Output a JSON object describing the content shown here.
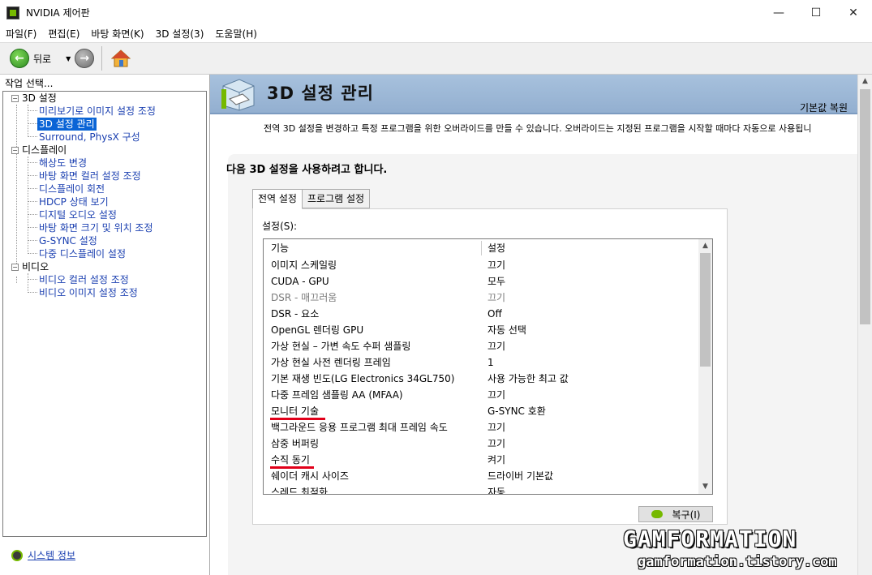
{
  "window": {
    "title": "NVIDIA 제어판",
    "minimize": "—",
    "maximize": "☐",
    "close": "✕"
  },
  "menu": [
    "파일(F)",
    "편집(E)",
    "바탕 화면(K)",
    "3D 설정(3)",
    "도움말(H)"
  ],
  "toolbar": {
    "back_label": "뒤로",
    "back_glyph": "←",
    "forward_glyph": "→",
    "dropdown_glyph": "▼"
  },
  "left": {
    "label": "작업 선택...",
    "tree": [
      {
        "text": "3D 설정",
        "type": "category",
        "expander": "−"
      },
      {
        "text": "미리보기로 이미지 설정 조정",
        "type": "link"
      },
      {
        "text": "3D 설정 관리",
        "type": "selected"
      },
      {
        "text": "Surround, PhysX 구성",
        "type": "link"
      },
      {
        "text": "디스플레이",
        "type": "category",
        "expander": "−"
      },
      {
        "text": "해상도 변경",
        "type": "link"
      },
      {
        "text": "바탕 화면 컬러 설정 조정",
        "type": "link"
      },
      {
        "text": "디스플레이 회전",
        "type": "link"
      },
      {
        "text": "HDCP 상태 보기",
        "type": "link"
      },
      {
        "text": "디지털 오디오 설정",
        "type": "link"
      },
      {
        "text": "바탕 화면 크기 및 위치 조정",
        "type": "link"
      },
      {
        "text": "G-SYNC 설정",
        "type": "link"
      },
      {
        "text": "다중 디스플레이 설정",
        "type": "link"
      },
      {
        "text": "비디오",
        "type": "category",
        "expander": "−"
      },
      {
        "text": "비디오 컬러 설정 조정",
        "type": "link"
      },
      {
        "text": "비디오 이미지 설정 조정",
        "type": "link"
      }
    ],
    "system_info": "시스템 정보"
  },
  "main": {
    "title": "3D 설정 관리",
    "restore_default": "기본값 복원",
    "description": "전역 3D 설정을 변경하고 특정 프로그램을 위한 오버라이드를 만들 수 있습니다. 오버라이드는 지정된 프로그램을 시작할 때마다 자동으로 사용됩니",
    "section_title": "다음 3D 설정을 사용하려고 합니다.",
    "tabs": [
      "전역 설정",
      "프로그램 설정"
    ],
    "settings_label": "설정(S):",
    "table": {
      "col_feature": "기능",
      "col_setting": "설정",
      "rows": [
        {
          "feature": "이미지 스케일링",
          "value": "끄기",
          "dim": false
        },
        {
          "feature": "CUDA - GPU",
          "value": "모두",
          "dim": false
        },
        {
          "feature": "DSR - 매끄러움",
          "value": "끄기",
          "dim": true
        },
        {
          "feature": "DSR - 요소",
          "value": "Off",
          "dim": false
        },
        {
          "feature": "OpenGL 렌더링 GPU",
          "value": "자동 선택",
          "dim": false
        },
        {
          "feature": "가상 현실 – 가변 속도 수퍼 샘플링",
          "value": "끄기",
          "dim": false
        },
        {
          "feature": "가상 현실 사전 렌더링 프레임",
          "value": "1",
          "dim": false
        },
        {
          "feature": "기본 재생 빈도(LG Electronics 34GL750)",
          "value": "사용 가능한 최고 값",
          "dim": false
        },
        {
          "feature": "다중 프레임 샘플링 AA (MFAA)",
          "value": "끄기",
          "dim": false
        },
        {
          "feature": "모니터 기술",
          "value": "G-SYNC 호환",
          "dim": false,
          "highlight": true
        },
        {
          "feature": "백그라운드 응용 프로그램 최대 프레임 속도",
          "value": "끄기",
          "dim": false
        },
        {
          "feature": "삼중 버퍼링",
          "value": "끄기",
          "dim": false
        },
        {
          "feature": "수직 동기",
          "value": "켜기",
          "dim": false,
          "highlight": true
        },
        {
          "feature": "쉐이더 캐시 사이즈",
          "value": "드라이버 기본값",
          "dim": false
        },
        {
          "feature": "스레드 최적화",
          "value": "자동",
          "dim": false
        }
      ]
    },
    "restore_button": "복구(I)"
  },
  "watermark": {
    "line1": "GAMFORMATION",
    "line2": "gamformation.tistory.com"
  },
  "colors": {
    "accent_blue": "#0a64d6",
    "header_blue": "#a7c1dd",
    "nvidia_green": "#76b900",
    "highlight_red": "#e1001a",
    "link": "#1a3fb0"
  }
}
